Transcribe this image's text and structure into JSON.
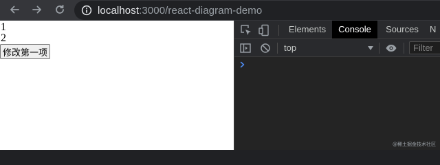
{
  "browser": {
    "url_host": "localhost",
    "url_rest": ":3000/react-diagram-demo"
  },
  "page": {
    "lines": [
      "1",
      "2"
    ],
    "button_label": "修改第一项"
  },
  "devtools": {
    "tabs": [
      "Elements",
      "Console",
      "Sources",
      "N"
    ],
    "active_tab": "Console",
    "context": "top",
    "filter_placeholder": "Filter",
    "prompt": "›"
  },
  "watermark": "@稀土掘金技术社区",
  "colors": {
    "toolbar": "#35363a",
    "devtools_bg": "#242424",
    "prompt": "#4e8df5"
  }
}
